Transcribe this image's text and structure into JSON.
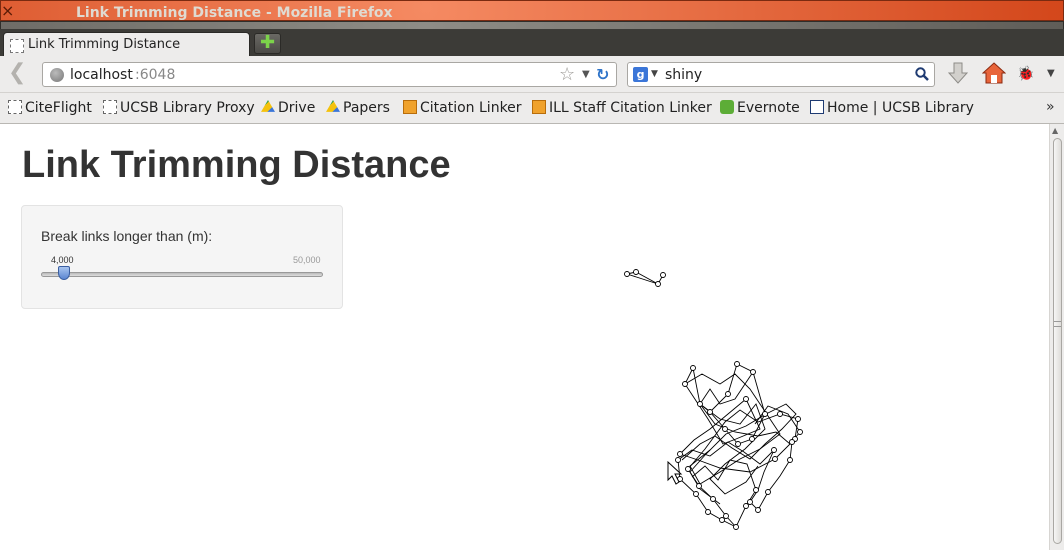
{
  "window": {
    "title": "Link Trimming Distance - Mozilla Firefox"
  },
  "tab": {
    "label": "Link Trimming Distance",
    "new_tab_symbol": "✚"
  },
  "navbar": {
    "url_host": "localhost",
    "url_port": ":6048",
    "search_engine": "g",
    "search_text": "shiny"
  },
  "bookmarks": [
    {
      "label": "CiteFlight",
      "icon": "dashed"
    },
    {
      "label": "UCSB Library Proxy",
      "icon": "dashed"
    },
    {
      "label": "Drive",
      "icon": "drive"
    },
    {
      "label": "Papers",
      "icon": "drive"
    },
    {
      "label": "Citation Linker",
      "icon": "orange"
    },
    {
      "label": "ILL Staff Citation Linker",
      "icon": "orange"
    },
    {
      "label": "Evernote",
      "icon": "evernote"
    },
    {
      "label": "Home | UCSB Library",
      "icon": "ucsb"
    }
  ],
  "bookmarks_more": "»",
  "page": {
    "title": "Link Trimming Distance",
    "slider": {
      "label": "Break links longer than (m):",
      "value_label": "4,000",
      "max_label": "50,000",
      "min": 0,
      "max": 50000,
      "value": 4000
    }
  },
  "colors": {
    "accent": "#3b76d8",
    "close": "#d3471b"
  }
}
